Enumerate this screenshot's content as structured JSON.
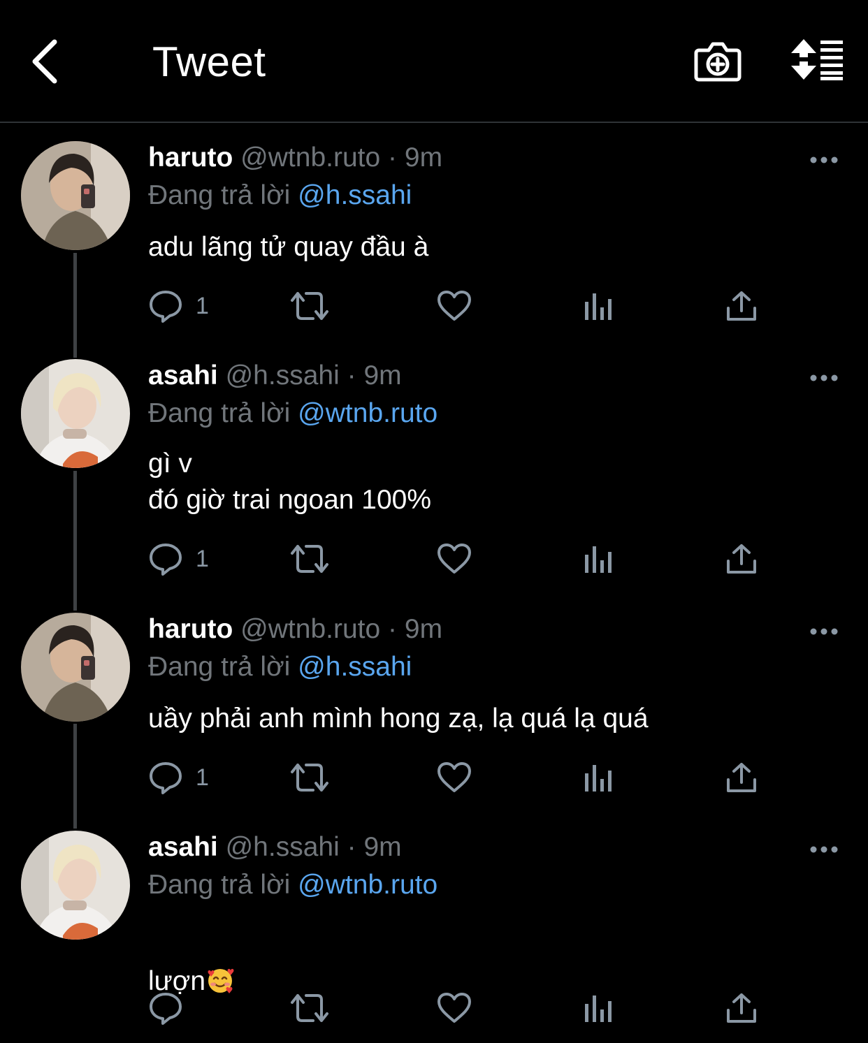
{
  "header": {
    "title": "Tweet"
  },
  "icons": {
    "back": "chevron-left-icon",
    "camera": "camera-plus-icon",
    "sort": "sort-lines-icon",
    "reply": "speech-bubble-icon",
    "retweet": "retweet-icon",
    "like": "heart-icon",
    "views": "bar-chart-icon",
    "share": "share-upload-icon",
    "more": "ellipsis-icon"
  },
  "colors": {
    "background": "#000000",
    "mention": "#5aa6ef",
    "muted": "#71767b",
    "text": "#ffffff"
  },
  "tweets": [
    {
      "name": "haruto",
      "handle": "@wtnb.ruto",
      "separator": "·",
      "time": "9m",
      "reply_prefix": "Đang trả lời",
      "reply_to": "@h.ssahi",
      "text": "adu lãng tử quay đầu à",
      "reply_count": "1"
    },
    {
      "name": "asahi",
      "handle": "@h.ssahi",
      "separator": "·",
      "time": "9m",
      "reply_prefix": "Đang trả lời",
      "reply_to": "@wtnb.ruto",
      "text": "gì v\nđó giờ trai ngoan 100%",
      "reply_count": "1"
    },
    {
      "name": "haruto",
      "handle": "@wtnb.ruto",
      "separator": "·",
      "time": "9m",
      "reply_prefix": "Đang trả lời",
      "reply_to": "@h.ssahi",
      "text": "uầy phải anh mình hong zạ, lạ quá lạ quá",
      "reply_count": "1"
    },
    {
      "name": "asahi",
      "handle": "@h.ssahi",
      "separator": "·",
      "time": "9m",
      "reply_prefix": "Đang trả lời",
      "reply_to": "@wtnb.ruto",
      "text": "lượn",
      "emoji": "smiling-face-with-hearts",
      "reply_count": ""
    }
  ]
}
